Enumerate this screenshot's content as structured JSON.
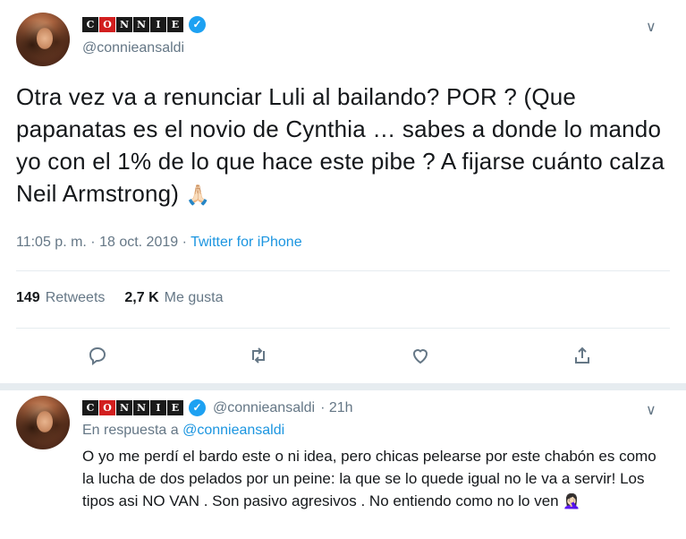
{
  "tweet": {
    "author": {
      "logo_letters": [
        "C",
        "O",
        "N",
        "N",
        "I",
        "E"
      ],
      "verified_glyph": "✓",
      "handle": "@connieansaldi"
    },
    "menu_glyph": "∨",
    "text": "Otra vez va a renunciar Luli al bailando? POR ? (Que papanatas es el novio de Cynthia … sabes a donde lo mando yo con el 1% de lo que hace este pibe ? A fijarse cuánto calza Neil Armstrong)",
    "emoji": "🙏🏻",
    "time": "11:05 p. m.",
    "separator": " · ",
    "date": "18 oct. 2019",
    "source": "Twitter for iPhone",
    "retweets_count": "149",
    "retweets_label": "Retweets",
    "likes_count": "2,7 K",
    "likes_label": "Me gusta",
    "actions": [
      "reply-icon",
      "retweet-icon",
      "like-icon",
      "share-icon"
    ]
  },
  "reply": {
    "author": {
      "logo_letters": [
        "C",
        "O",
        "N",
        "N",
        "I",
        "E"
      ],
      "verified_glyph": "✓",
      "handle": "@connieansaldi",
      "time": "· 21h"
    },
    "menu_glyph": "∨",
    "in_reply_prefix": "En respuesta a ",
    "in_reply_handle": "@connieansaldi",
    "text": "O yo me perdí el bardo este o ni idea, pero chicas pelearse por este chabón es como la lucha de dos pelados por un peine: la que se lo quede igual no le va a servir! Los tipos asi NO VAN . Son pasivo agresivos . No entiendo como no lo ven",
    "emoji": "🤦🏻‍♀️"
  },
  "colors": {
    "accent": "#1b95e0",
    "muted": "#657786",
    "logo_red": "#d21f1f",
    "logo_black": "#1a1a1a"
  }
}
